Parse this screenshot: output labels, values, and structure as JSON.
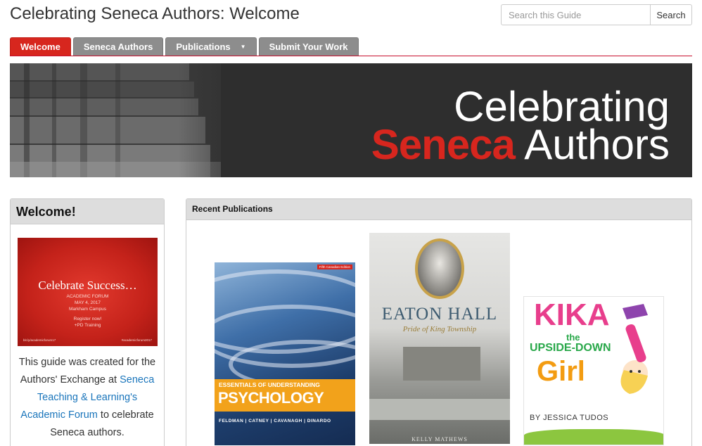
{
  "page": {
    "title": "Celebrating Seneca Authors: Welcome"
  },
  "search": {
    "placeholder": "Search this Guide",
    "button_label": "Search"
  },
  "tabs": [
    {
      "label": "Welcome",
      "active": true
    },
    {
      "label": "Seneca Authors",
      "active": false
    },
    {
      "label": "Publications",
      "active": false,
      "has_dropdown": true
    },
    {
      "label": "Submit Your Work",
      "active": false
    }
  ],
  "banner": {
    "line1": "Celebrating",
    "brand": "Seneca",
    "line2_rest": "Authors"
  },
  "welcome": {
    "heading": "Welcome!",
    "promo": {
      "title_a": "Celebrate",
      "title_b": "Success…",
      "line1": "ACADEMIC FORUM",
      "line2": "MAY 4, 2017",
      "line3": "Markham Campus",
      "line4": "Register now!",
      "line5": "+PD Training",
      "foot_left": "bit.ly/academicforum17",
      "foot_right": "#academicforum2017"
    },
    "text_before": "This guide was created for the Authors' Exchange at ",
    "link_text": "Seneca Teaching & Learning's Academic Forum",
    "text_after": " to celebrate Seneca authors."
  },
  "publications": {
    "heading": "Recent Publications",
    "books": [
      {
        "edition": "Fifth Canadian Edition",
        "subtitle": "ESSENTIALS OF UNDERSTANDING",
        "title": "PSYCHOLOGY",
        "authors": "FELDMAN | CATNEY | CAVANAGH | DINARDO"
      },
      {
        "title": "EATON HALL",
        "subtitle": "Pride of King Township",
        "author": "KELLY MATHEWS"
      },
      {
        "title": "KIKA",
        "title_the": "the",
        "title_upside": "UPSIDE-DOWN",
        "title_girl": "Girl",
        "author": "BY JESSICA TUDOS"
      }
    ]
  },
  "colors": {
    "accent": "#d7261e",
    "tab_inactive": "#8d8d8d",
    "link": "#1a75bb",
    "banner_bg": "#2e2e2e"
  }
}
